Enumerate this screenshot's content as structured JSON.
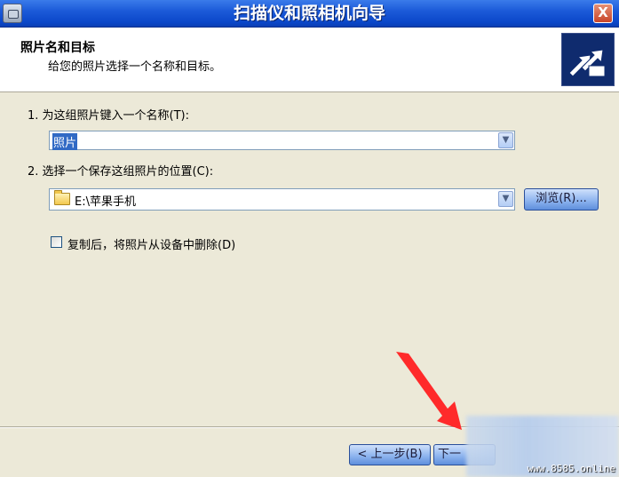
{
  "window": {
    "title": "扫描仪和照相机向导",
    "close_label": "X"
  },
  "header": {
    "title": "照片名和目标",
    "subtitle": "给您的照片选择一个名称和目标。"
  },
  "step1": {
    "label": "1. 为这组照片键入一个名称(T):",
    "value": "照片"
  },
  "step2": {
    "label": "2. 选择一个保存这组照片的位置(C):",
    "value": "E:\\苹果手机",
    "browse_label": "浏览(R)..."
  },
  "delete_option": {
    "label": "复制后，将照片从设备中删除(D)",
    "checked": false
  },
  "footer": {
    "back_label": "< 上一步(B)",
    "next_label": "下一"
  },
  "watermark": "www.8585.online",
  "colors": {
    "titlebar": "#0a46c8",
    "arrow": "#ff2a2a",
    "selection": "#316ac5"
  },
  "icons": {
    "app": "camera-icon",
    "header": "wizard-arrows-icon",
    "folder": "folder-icon",
    "dropdown": "chevron-down-icon"
  }
}
